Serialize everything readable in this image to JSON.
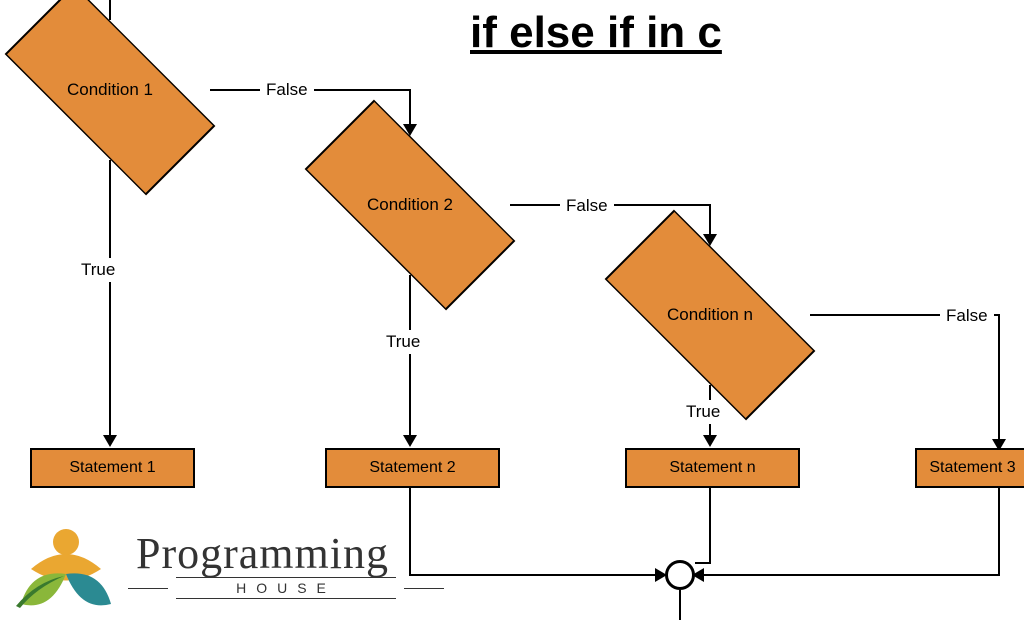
{
  "title": "if else if in c",
  "diamonds": {
    "c1": "Condition 1",
    "c2": "Condition 2",
    "cn": "Condition n"
  },
  "rects": {
    "s1": "Statement 1",
    "s2": "Statement 2",
    "sn": "Statement n",
    "s3": "Statement 3"
  },
  "labels": {
    "true1": "True",
    "true2": "True",
    "truen": "True",
    "false1": "False",
    "false2": "False",
    "falsen": "False"
  },
  "logo": {
    "main": "Programming",
    "sub": "HOUSE"
  },
  "colors": {
    "shapeFill": "#e38c3a",
    "shapeStroke": "#000000"
  }
}
